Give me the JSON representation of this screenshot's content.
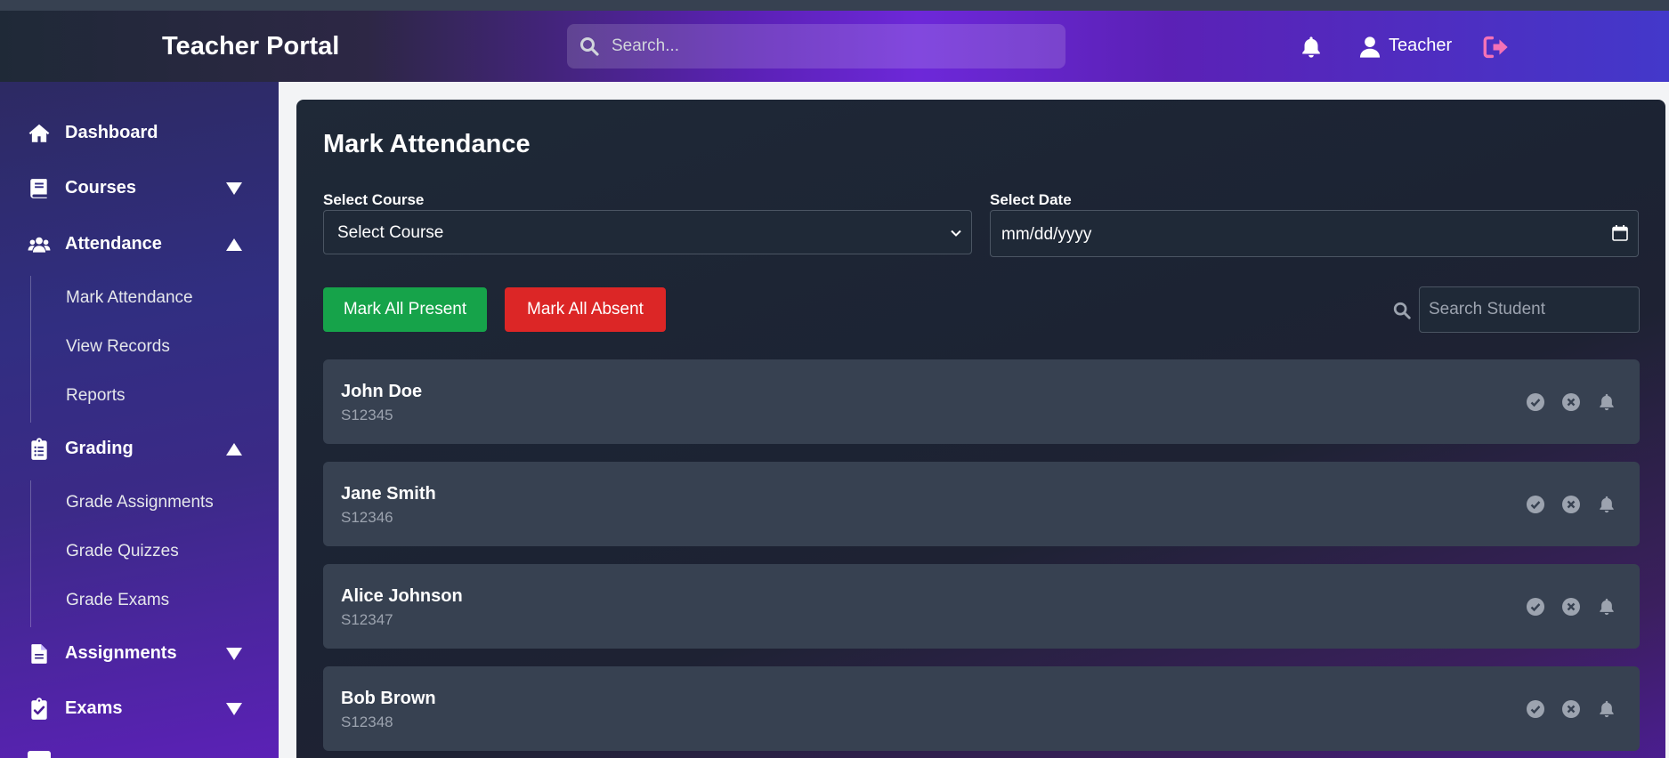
{
  "header": {
    "brand": "Teacher Portal",
    "search_placeholder": "Search...",
    "user_label": "Teacher"
  },
  "sidebar": {
    "items": [
      {
        "label": "Dashboard",
        "icon": "home-icon"
      },
      {
        "label": "Courses",
        "icon": "book-icon",
        "expanded": false
      },
      {
        "label": "Attendance",
        "icon": "users-icon",
        "expanded": true,
        "children": [
          "Mark Attendance",
          "View Records",
          "Reports"
        ]
      },
      {
        "label": "Grading",
        "icon": "clipboard-list-icon",
        "expanded": true,
        "children": [
          "Grade Assignments",
          "Grade Quizzes",
          "Grade Exams"
        ]
      },
      {
        "label": "Assignments",
        "icon": "file-icon",
        "expanded": false
      },
      {
        "label": "Exams",
        "icon": "clipboard-check-icon",
        "expanded": false
      }
    ]
  },
  "main": {
    "title": "Mark Attendance",
    "course_label": "Select Course",
    "course_value": "Select Course",
    "date_label": "Select Date",
    "date_value": "mm/dd/yyyy",
    "mark_all_present": "Mark All Present",
    "mark_all_absent": "Mark All Absent",
    "student_search_placeholder": "Search Student",
    "students": [
      {
        "name": "John Doe",
        "id": "S12345"
      },
      {
        "name": "Jane Smith",
        "id": "S12346"
      },
      {
        "name": "Alice Johnson",
        "id": "S12347"
      },
      {
        "name": "Bob Brown",
        "id": "S12348"
      }
    ]
  },
  "colors": {
    "present": "#16a34a",
    "absent": "#dc2626",
    "logout": "#f472b6"
  }
}
